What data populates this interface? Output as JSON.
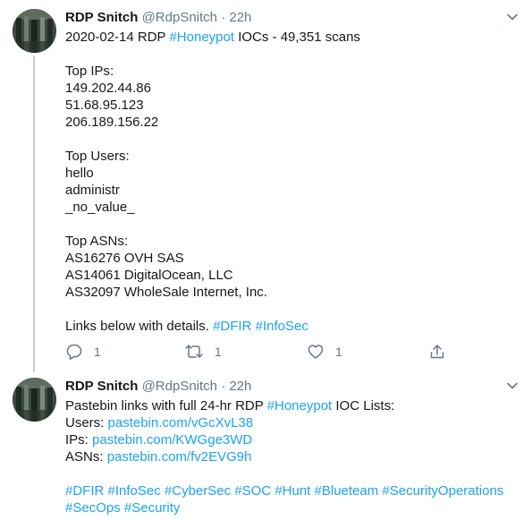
{
  "tweets": [
    {
      "name": "RDP Snitch",
      "handle": "@RdpSnitch",
      "dot": "·",
      "time": "22h",
      "lines": [
        [
          {
            "t": "2020-02-14 RDP "
          },
          {
            "t": "#Honeypot",
            "hl": true
          },
          {
            "t": " IOCs - 49,351 scans"
          }
        ],
        [],
        [
          {
            "t": "Top IPs:"
          }
        ],
        [
          {
            "t": "149.202.44.86"
          }
        ],
        [
          {
            "t": "51.68.95.123"
          }
        ],
        [
          {
            "t": "206.189.156.22"
          }
        ],
        [],
        [
          {
            "t": "Top Users:"
          }
        ],
        [
          {
            "t": "hello"
          }
        ],
        [
          {
            "t": "administr"
          }
        ],
        [
          {
            "t": "_no_value_"
          }
        ],
        [],
        [
          {
            "t": "Top ASNs:"
          }
        ],
        [
          {
            "t": "AS16276 OVH SAS"
          }
        ],
        [
          {
            "t": "AS14061 DigitalOcean, LLC"
          }
        ],
        [
          {
            "t": "AS32097 WholeSale Internet, Inc."
          }
        ],
        [],
        [
          {
            "t": "Links below with details. "
          },
          {
            "t": "#DFIR",
            "hl": true
          },
          {
            "t": " "
          },
          {
            "t": "#InfoSec",
            "hl": true
          }
        ]
      ],
      "actions": {
        "reply": {
          "icon": "reply-icon",
          "count": "1"
        },
        "retweet": {
          "icon": "retweet-icon",
          "count": "1"
        },
        "like": {
          "icon": "heart-icon",
          "count": "1"
        },
        "share": {
          "icon": "share-icon"
        }
      }
    },
    {
      "name": "RDP Snitch",
      "handle": "@RdpSnitch",
      "dot": "·",
      "time": "22h",
      "lines": [
        [
          {
            "t": "Pastebin links with full 24-hr RDP "
          },
          {
            "t": "#Honeypot",
            "hl": true
          },
          {
            "t": " IOC Lists:"
          }
        ],
        [
          {
            "t": "Users: "
          },
          {
            "t": "pastebin.com/vGcXvL38",
            "hl": true
          }
        ],
        [
          {
            "t": "IPs: "
          },
          {
            "t": "pastebin.com/KWGge3WD",
            "hl": true
          }
        ],
        [
          {
            "t": "ASNs: "
          },
          {
            "t": "pastebin.com/fv2EVG9h",
            "hl": true
          }
        ],
        [],
        [
          {
            "t": "#DFIR",
            "hl": true
          },
          {
            "t": " "
          },
          {
            "t": "#InfoSec",
            "hl": true
          },
          {
            "t": " "
          },
          {
            "t": "#CyberSec",
            "hl": true
          },
          {
            "t": " "
          },
          {
            "t": "#SOC",
            "hl": true
          },
          {
            "t": " "
          },
          {
            "t": "#Hunt",
            "hl": true
          },
          {
            "t": " "
          },
          {
            "t": "#Blueteam",
            "hl": true
          },
          {
            "t": " "
          },
          {
            "t": "#SecurityOperations",
            "hl": true
          }
        ],
        [
          {
            "t": "#SecOps",
            "hl": true
          },
          {
            "t": " "
          },
          {
            "t": "#Security",
            "hl": true
          }
        ]
      ]
    }
  ],
  "colors": {
    "link": "#1da1f2",
    "muted": "#657786",
    "text": "#14171a",
    "thread": "#c4cfd6"
  }
}
